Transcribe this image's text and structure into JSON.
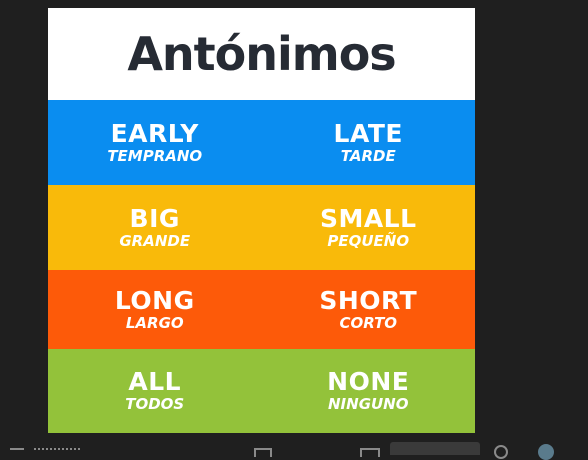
{
  "title": "Antónimos",
  "colors": {
    "background": "#1f1f1f",
    "title_text": "#262b34",
    "row1": "#0a8df0",
    "row2": "#f9ba0a",
    "row3": "#fd5a09",
    "row4": "#93c23a"
  },
  "pairs": [
    {
      "left_en": "EARLY",
      "left_es": "TEMPRANO",
      "right_en": "LATE",
      "right_es": "TARDE"
    },
    {
      "left_en": "BIG",
      "left_es": "GRANDE",
      "right_en": "SMALL",
      "right_es": "PEQUEÑO"
    },
    {
      "left_en": "LONG",
      "left_es": "LARGO",
      "right_en": "SHORT",
      "right_es": "CORTO"
    },
    {
      "left_en": "ALL",
      "left_es": "TODOS",
      "right_en": "NONE",
      "right_es": "NINGUNO"
    }
  ],
  "taskbar": {
    "icons": [
      "menu-icon",
      "tray-icon",
      "fullscreen-icon",
      "caption-icon",
      "zoom-control",
      "search-icon",
      "avatar"
    ]
  }
}
